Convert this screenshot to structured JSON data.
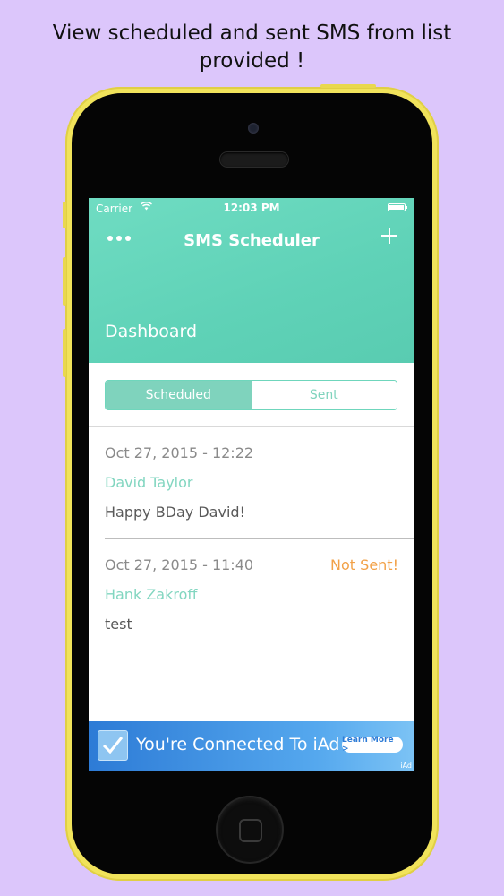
{
  "caption": {
    "line1": "View scheduled and sent SMS from list",
    "line2": "provided !"
  },
  "statusbar": {
    "carrier": "Carrier",
    "time": "12:03 PM",
    "wifi_icon": "wifi-icon",
    "battery_icon": "battery-icon"
  },
  "header": {
    "menu_icon": "more-dots-icon",
    "title": "SMS Scheduler",
    "add_icon": "plus-icon",
    "add_label": "+",
    "section": "Dashboard"
  },
  "segments": {
    "scheduled": "Scheduled",
    "sent": "Sent",
    "selected": "Scheduled"
  },
  "items": [
    {
      "date": "Oct 27, 2015 - 12:22",
      "status": "",
      "name": "David Taylor",
      "message": "Happy BDay David!"
    },
    {
      "date": "Oct 27, 2015 - 11:40",
      "status": "Not Sent!",
      "name": "Hank Zakroff",
      "message": "test"
    }
  ],
  "ad": {
    "text": "You're Connected To iAd",
    "button": "Learn More >",
    "label": "iAd",
    "icon": "checkmark-icon"
  },
  "colors": {
    "background": "#dcc6fb",
    "phone_body": "#f1e35b",
    "accent": "#5fd2b7",
    "status_not_sent": "#f2a147",
    "ad_blue": "#2d7bd6"
  }
}
